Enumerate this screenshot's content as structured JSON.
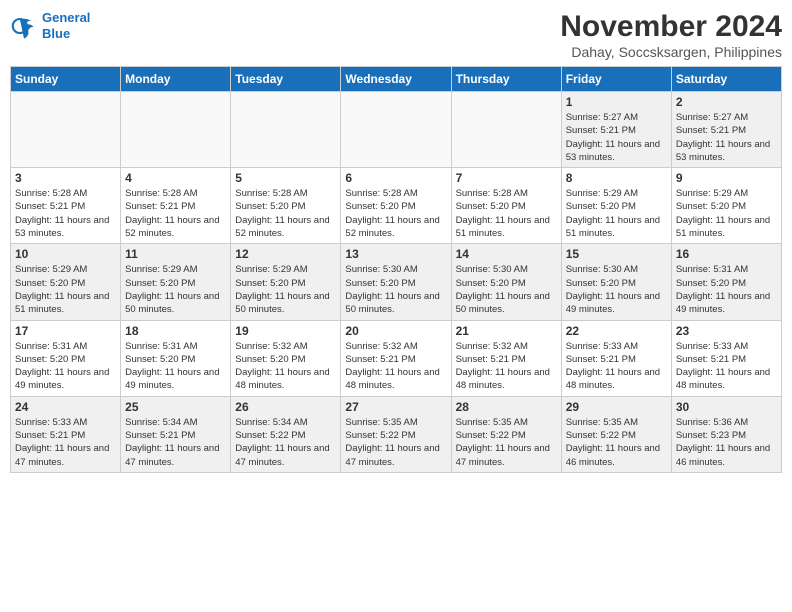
{
  "logo": {
    "line1": "General",
    "line2": "Blue"
  },
  "title": "November 2024",
  "subtitle": "Dahay, Soccsksargen, Philippines",
  "weekdays": [
    "Sunday",
    "Monday",
    "Tuesday",
    "Wednesday",
    "Thursday",
    "Friday",
    "Saturday"
  ],
  "weeks": [
    [
      {
        "day": "",
        "info": ""
      },
      {
        "day": "",
        "info": ""
      },
      {
        "day": "",
        "info": ""
      },
      {
        "day": "",
        "info": ""
      },
      {
        "day": "",
        "info": ""
      },
      {
        "day": "1",
        "info": "Sunrise: 5:27 AM\nSunset: 5:21 PM\nDaylight: 11 hours\nand 53 minutes."
      },
      {
        "day": "2",
        "info": "Sunrise: 5:27 AM\nSunset: 5:21 PM\nDaylight: 11 hours\nand 53 minutes."
      }
    ],
    [
      {
        "day": "3",
        "info": "Sunrise: 5:28 AM\nSunset: 5:21 PM\nDaylight: 11 hours\nand 53 minutes."
      },
      {
        "day": "4",
        "info": "Sunrise: 5:28 AM\nSunset: 5:21 PM\nDaylight: 11 hours\nand 52 minutes."
      },
      {
        "day": "5",
        "info": "Sunrise: 5:28 AM\nSunset: 5:20 PM\nDaylight: 11 hours\nand 52 minutes."
      },
      {
        "day": "6",
        "info": "Sunrise: 5:28 AM\nSunset: 5:20 PM\nDaylight: 11 hours\nand 52 minutes."
      },
      {
        "day": "7",
        "info": "Sunrise: 5:28 AM\nSunset: 5:20 PM\nDaylight: 11 hours\nand 51 minutes."
      },
      {
        "day": "8",
        "info": "Sunrise: 5:29 AM\nSunset: 5:20 PM\nDaylight: 11 hours\nand 51 minutes."
      },
      {
        "day": "9",
        "info": "Sunrise: 5:29 AM\nSunset: 5:20 PM\nDaylight: 11 hours\nand 51 minutes."
      }
    ],
    [
      {
        "day": "10",
        "info": "Sunrise: 5:29 AM\nSunset: 5:20 PM\nDaylight: 11 hours\nand 51 minutes."
      },
      {
        "day": "11",
        "info": "Sunrise: 5:29 AM\nSunset: 5:20 PM\nDaylight: 11 hours\nand 50 minutes."
      },
      {
        "day": "12",
        "info": "Sunrise: 5:29 AM\nSunset: 5:20 PM\nDaylight: 11 hours\nand 50 minutes."
      },
      {
        "day": "13",
        "info": "Sunrise: 5:30 AM\nSunset: 5:20 PM\nDaylight: 11 hours\nand 50 minutes."
      },
      {
        "day": "14",
        "info": "Sunrise: 5:30 AM\nSunset: 5:20 PM\nDaylight: 11 hours\nand 50 minutes."
      },
      {
        "day": "15",
        "info": "Sunrise: 5:30 AM\nSunset: 5:20 PM\nDaylight: 11 hours\nand 49 minutes."
      },
      {
        "day": "16",
        "info": "Sunrise: 5:31 AM\nSunset: 5:20 PM\nDaylight: 11 hours\nand 49 minutes."
      }
    ],
    [
      {
        "day": "17",
        "info": "Sunrise: 5:31 AM\nSunset: 5:20 PM\nDaylight: 11 hours\nand 49 minutes."
      },
      {
        "day": "18",
        "info": "Sunrise: 5:31 AM\nSunset: 5:20 PM\nDaylight: 11 hours\nand 49 minutes."
      },
      {
        "day": "19",
        "info": "Sunrise: 5:32 AM\nSunset: 5:20 PM\nDaylight: 11 hours\nand 48 minutes."
      },
      {
        "day": "20",
        "info": "Sunrise: 5:32 AM\nSunset: 5:21 PM\nDaylight: 11 hours\nand 48 minutes."
      },
      {
        "day": "21",
        "info": "Sunrise: 5:32 AM\nSunset: 5:21 PM\nDaylight: 11 hours\nand 48 minutes."
      },
      {
        "day": "22",
        "info": "Sunrise: 5:33 AM\nSunset: 5:21 PM\nDaylight: 11 hours\nand 48 minutes."
      },
      {
        "day": "23",
        "info": "Sunrise: 5:33 AM\nSunset: 5:21 PM\nDaylight: 11 hours\nand 48 minutes."
      }
    ],
    [
      {
        "day": "24",
        "info": "Sunrise: 5:33 AM\nSunset: 5:21 PM\nDaylight: 11 hours\nand 47 minutes."
      },
      {
        "day": "25",
        "info": "Sunrise: 5:34 AM\nSunset: 5:21 PM\nDaylight: 11 hours\nand 47 minutes."
      },
      {
        "day": "26",
        "info": "Sunrise: 5:34 AM\nSunset: 5:22 PM\nDaylight: 11 hours\nand 47 minutes."
      },
      {
        "day": "27",
        "info": "Sunrise: 5:35 AM\nSunset: 5:22 PM\nDaylight: 11 hours\nand 47 minutes."
      },
      {
        "day": "28",
        "info": "Sunrise: 5:35 AM\nSunset: 5:22 PM\nDaylight: 11 hours\nand 47 minutes."
      },
      {
        "day": "29",
        "info": "Sunrise: 5:35 AM\nSunset: 5:22 PM\nDaylight: 11 hours\nand 46 minutes."
      },
      {
        "day": "30",
        "info": "Sunrise: 5:36 AM\nSunset: 5:23 PM\nDaylight: 11 hours\nand 46 minutes."
      }
    ]
  ]
}
